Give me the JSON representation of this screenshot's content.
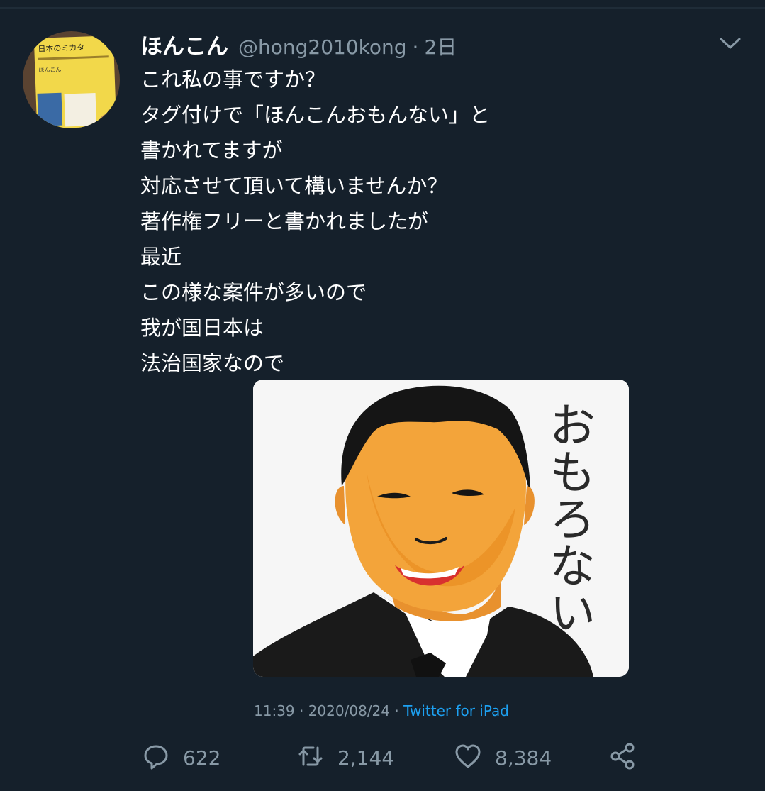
{
  "tweet": {
    "author": {
      "display_name": "ほんこん",
      "handle": "@hong2010kong",
      "avatar_book_title": "日本のミカタ",
      "avatar_book_author": "ほんこん"
    },
    "relative_time": "2日",
    "lines": [
      "これ私の事ですか？",
      "タグ付けで「ほんこんおもんない」と",
      "書かれてますが",
      "対応させて頂いて構いませんか？",
      "著作権フリーと書かれましたが",
      "最近",
      "この様な案件が多いので",
      "我が国日本は",
      "法治国家なので"
    ],
    "media": {
      "drawn_text": "おもろない"
    },
    "meta": {
      "timestamp": "11:39 · 2020/08/24 · ",
      "source": "Twitter for iPad"
    },
    "actions": {
      "replies": "622",
      "retweets": "2,144",
      "likes": "8,384"
    }
  },
  "icons": {
    "menu": "chevron-down-icon",
    "reply": "reply-icon",
    "retweet": "retweet-icon",
    "like": "heart-icon",
    "share": "share-icon"
  },
  "colors": {
    "background": "#15202b",
    "secondary_text": "#8899a6",
    "link": "#1da1f2"
  }
}
